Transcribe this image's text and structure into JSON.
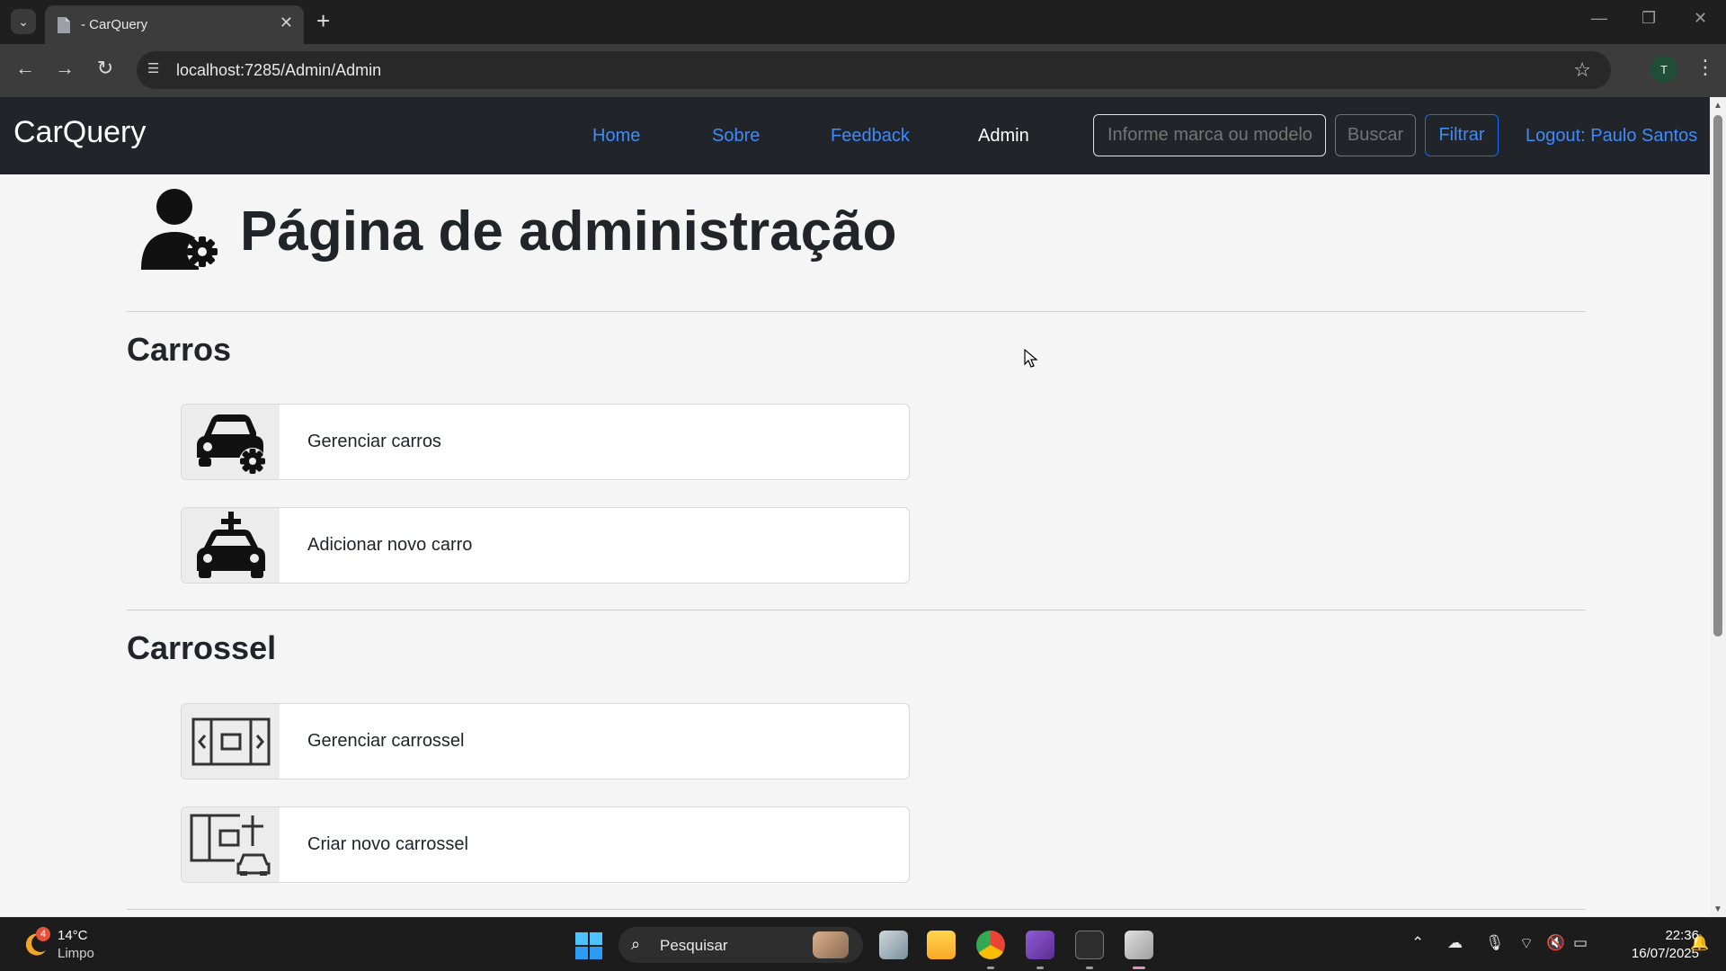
{
  "browser": {
    "tab_title": "- CarQuery",
    "url": "localhost:7285/Admin/Admin",
    "profile_initial": "T"
  },
  "navbar": {
    "brand": "CarQuery",
    "links": [
      "Home",
      "Sobre",
      "Feedback",
      "Admin"
    ],
    "active_link": "Admin",
    "search_placeholder": "Informe marca ou modelo",
    "buscar_label": "Buscar",
    "filtrar_label": "Filtrar",
    "logout_label": "Logout: Paulo Santos"
  },
  "page": {
    "title": "Página de administração",
    "sections": [
      {
        "title": "Carros",
        "cards": [
          {
            "label": "Gerenciar carros",
            "icon": "car-gear-icon"
          },
          {
            "label": "Adicionar novo carro",
            "icon": "car-plus-icon"
          }
        ]
      },
      {
        "title": "Carrossel",
        "cards": [
          {
            "label": "Gerenciar carrossel",
            "icon": "carousel-icon"
          },
          {
            "label": "Criar novo carrossel",
            "icon": "carousel-plus-icon"
          }
        ]
      }
    ]
  },
  "taskbar": {
    "weather_badge": "4",
    "temperature": "14°C",
    "weather": "Limpo",
    "search_label": "Pesquisar",
    "time": "22:36",
    "date": "16/07/2025"
  },
  "colors": {
    "navbar_bg": "#212529",
    "link": "#3d8bfd",
    "primary": "#0d6efd",
    "secondary": "#6c757d",
    "page_bg": "#f5f5f5"
  }
}
